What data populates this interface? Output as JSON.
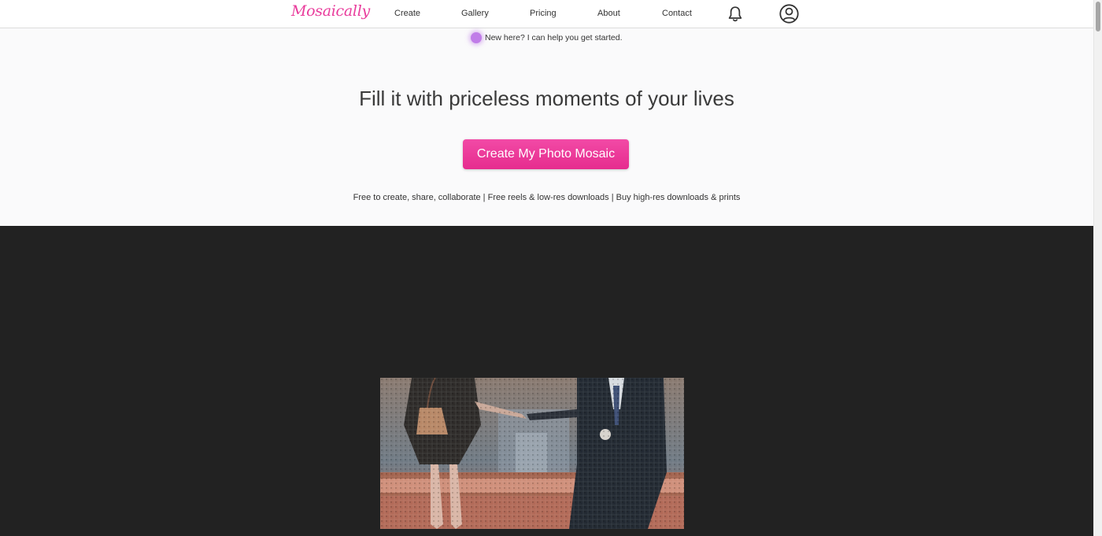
{
  "app": {
    "logo_text": "Mosaically",
    "brand_color": "#e93c9c"
  },
  "nav": {
    "items": [
      {
        "label": "Create"
      },
      {
        "label": "Gallery"
      },
      {
        "label": "Pricing"
      },
      {
        "label": "About"
      },
      {
        "label": "Contact"
      }
    ],
    "icons": [
      "bell-icon",
      "account-icon"
    ]
  },
  "hero": {
    "helper_text": "New here? I can help you get started.",
    "headline": "Fill it with priceless moments of your lives",
    "cta_label": "Create My Photo Mosaic",
    "tagline": "Free to create, share, collaborate | Free reels & low-res downloads | Buy high-res downloads & prints"
  },
  "showcase": {
    "image": "photo-mosaic-couple-holding-hands"
  },
  "colors": {
    "cta_gradient_top": "#f24aa6",
    "cta_gradient_bottom": "#e62c8e",
    "helper_dot": "#c07ce8",
    "dark_section": "#222222"
  }
}
